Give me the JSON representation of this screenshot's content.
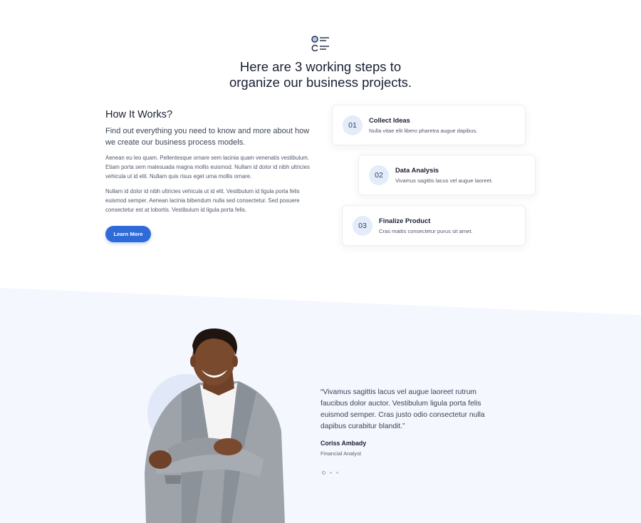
{
  "intro": {
    "icon": "steps-list-icon",
    "headline_line1": "Here are 3 working steps to",
    "headline_line2": "organize our business projects."
  },
  "how_it_works": {
    "title": "How It Works?",
    "lead": "Find out everything you need to know and more about how we create our business process models.",
    "paragraph1": "Aenean eu leo quam. Pellentesque ornare sem lacinia quam venenatis vestibulum. Etiam porta sem malesuada magna mollis euismod. Nullam id dolor id nibh ultricies vehicula ut id elit. Nullam quis risus eget urna mollis ornare.",
    "paragraph2": "Nullam id dolor id nibh ultricies vehicula ut id elit. Vestibulum id ligula porta felis euismod semper. Aenean lacinia bibendum nulla sed consectetur. Sed posuere consectetur est at lobortis. Vestibulum id ligula porta felis.",
    "button_label": "Learn More"
  },
  "steps": [
    {
      "number": "01",
      "title": "Collect Ideas",
      "description": "Nulla vitae elit libero pharetra augue dapibus."
    },
    {
      "number": "02",
      "title": "Data Analysis",
      "description": "Vivamus sagittis lacus vel augue laoreet."
    },
    {
      "number": "03",
      "title": "Finalize Product",
      "description": "Cras mattis consectetur purus sit amet."
    }
  ],
  "testimonial": {
    "quote": "“Vivamus sagittis lacus vel augue laoreet rutrum faucibus dolor auctor. Vestibulum ligula porta felis euismod semper. Cras justo odio consectetur nulla dapibus curabitur blandit.”",
    "author": "Coriss Ambady",
    "role": "Financial Analyst",
    "slides": 3,
    "active_slide": 1
  },
  "colors": {
    "accent": "#2f6ad9",
    "band_background": "#f4f7fe",
    "step_badge": "#e4ecf9"
  }
}
